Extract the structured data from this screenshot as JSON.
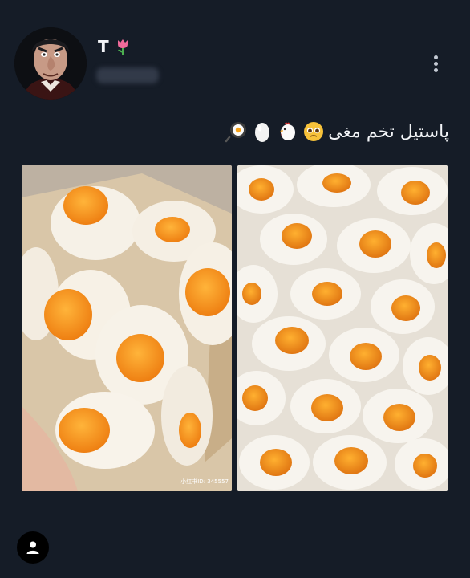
{
  "post": {
    "author_name": "T",
    "caption_text": "پاستیل تخم مغی",
    "caption_emojis": [
      "pleading-face",
      "chicken",
      "egg",
      "fried-egg-pan"
    ],
    "image_watermark": "小红书ID: 345557"
  },
  "colors": {
    "background": "#151c27",
    "egg_white": "#f4efe6",
    "yolk": "#f39a1e"
  },
  "icons": {
    "menu": "vertical-ellipsis-icon",
    "name_emoji": "tulip-icon",
    "bottom": "user-icon"
  }
}
